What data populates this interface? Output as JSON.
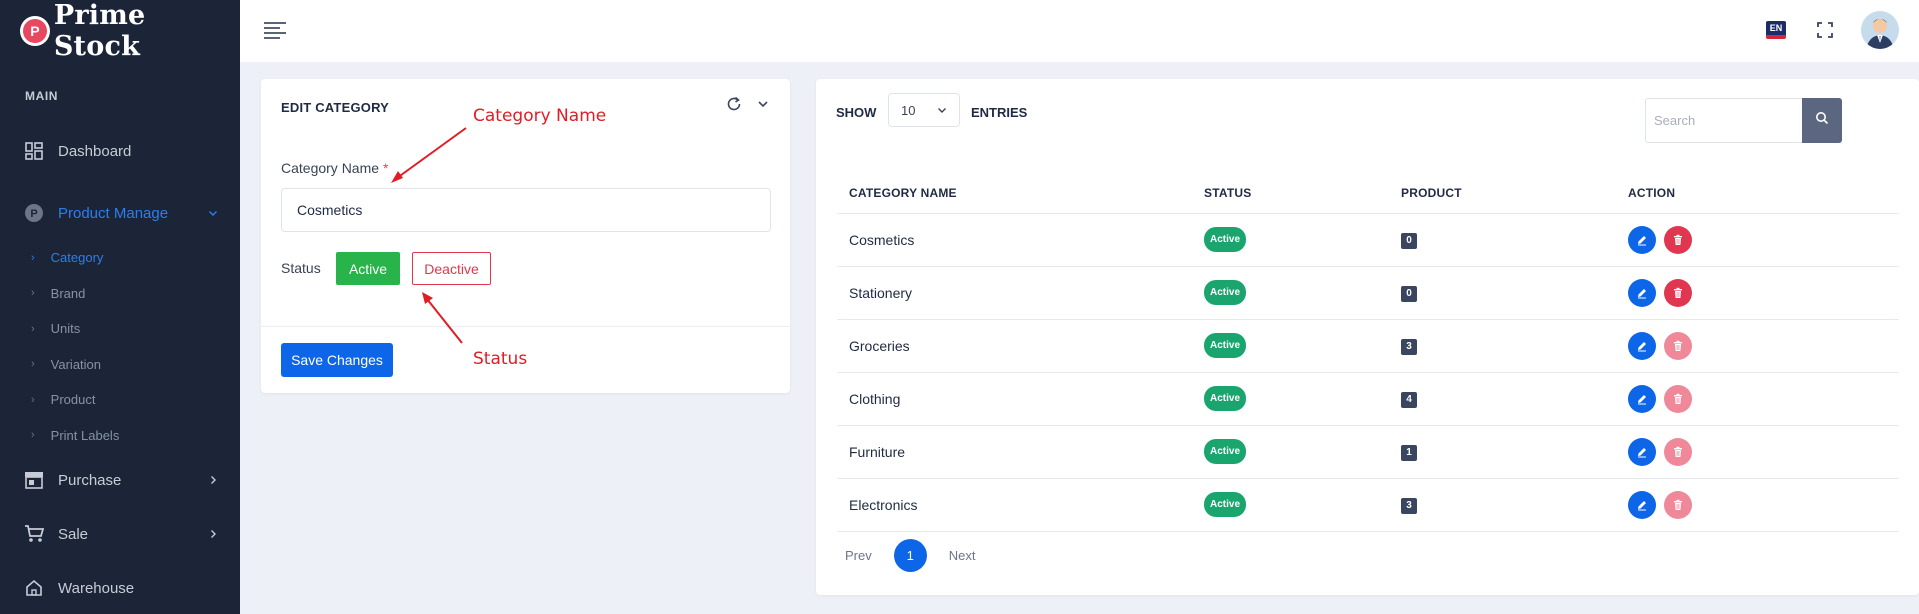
{
  "brand": {
    "name": "Prime Stock",
    "mark": "P"
  },
  "sidebar": {
    "section_label": "MAIN",
    "items": [
      {
        "label": "Dashboard",
        "icon": "dashboard-icon"
      },
      {
        "label": "Product Manage",
        "icon": "product-icon",
        "active": true
      },
      {
        "label": "Purchase",
        "icon": "store-icon"
      },
      {
        "label": "Sale",
        "icon": "cart-icon"
      },
      {
        "label": "Warehouse",
        "icon": "home-icon"
      }
    ],
    "sub_items": [
      {
        "label": "Category",
        "active": true
      },
      {
        "label": "Brand"
      },
      {
        "label": "Units"
      },
      {
        "label": "Variation"
      },
      {
        "label": "Product"
      },
      {
        "label": "Print Labels"
      }
    ]
  },
  "topbar": {
    "language": "EN"
  },
  "edit_form": {
    "title": "EDIT CATEGORY",
    "name_label": "Category Name",
    "required_mark": "*",
    "name_value": "Cosmetics",
    "status_label": "Status",
    "active_label": "Active",
    "deactive_label": "Deactive",
    "save_label": "Save Changes"
  },
  "annotations": {
    "category_name": "Category Name",
    "status": "Status"
  },
  "list": {
    "show_label": "SHOW",
    "entries_label": "ENTRIES",
    "page_size": "10",
    "search_placeholder": "Search",
    "columns": [
      "CATEGORY NAME",
      "STATUS",
      "PRODUCT",
      "ACTION"
    ],
    "rows": [
      {
        "name": "Cosmetics",
        "status": "Active",
        "product": "0",
        "delete_enabled": true
      },
      {
        "name": "Stationery",
        "status": "Active",
        "product": "0",
        "delete_enabled": true
      },
      {
        "name": "Groceries",
        "status": "Active",
        "product": "3",
        "delete_enabled": false
      },
      {
        "name": "Clothing",
        "status": "Active",
        "product": "4",
        "delete_enabled": false
      },
      {
        "name": "Furniture",
        "status": "Active",
        "product": "1",
        "delete_enabled": false
      },
      {
        "name": "Electronics",
        "status": "Active",
        "product": "3",
        "delete_enabled": false
      }
    ],
    "pagination": {
      "prev": "Prev",
      "current": "1",
      "next": "Next"
    }
  }
}
